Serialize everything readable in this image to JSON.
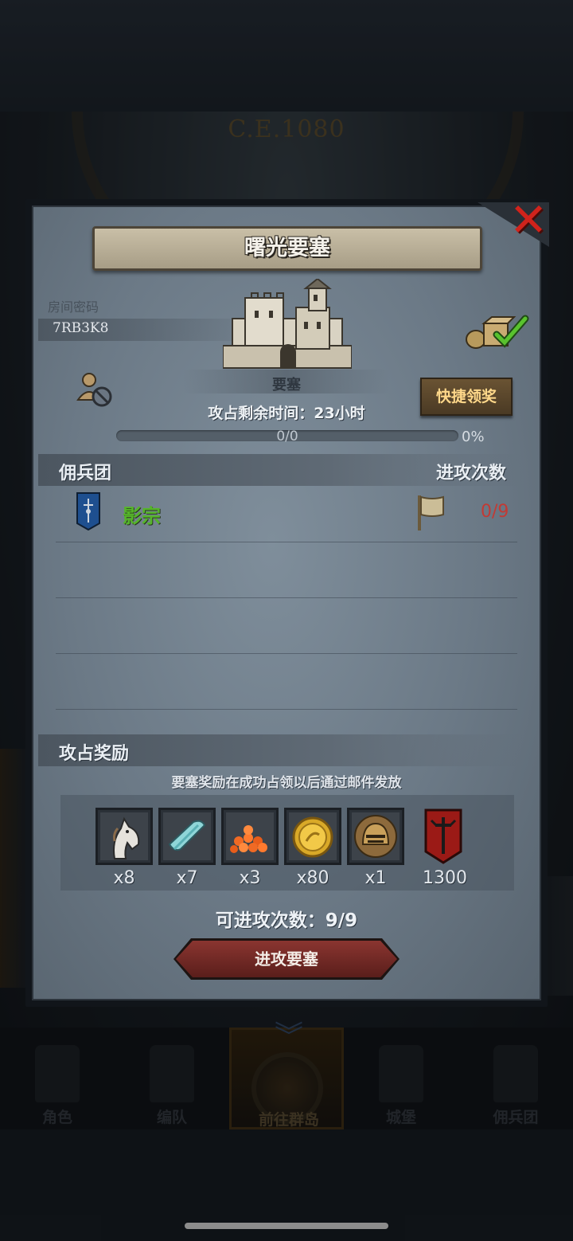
{
  "background": {
    "year": "C.E.1080"
  },
  "bottom_nav": [
    {
      "label": "角色",
      "icon": "knight-icon"
    },
    {
      "label": "编队",
      "icon": "team-icon"
    },
    {
      "label": "前往群岛",
      "icon": "compass-map-icon",
      "active": true
    },
    {
      "label": "城堡",
      "icon": "castle-icon"
    },
    {
      "label": "佣兵团",
      "icon": "ship-icon"
    }
  ],
  "modal": {
    "title": "曙光要塞",
    "room_label": "房间密码",
    "room_code": "7RB3K8",
    "fortress_label": "要塞",
    "quick_claim_label": "快捷领奖",
    "remaining_time": "攻占剩余时间：23小时",
    "progress": {
      "count": "0/0",
      "percent": "0%",
      "fraction": 0
    },
    "mercenary_header": "佣兵团",
    "attack_count_header": "进攻次数",
    "guild": {
      "name": "影宗",
      "attacks": "0/9"
    },
    "rewards_header": "攻占奖励",
    "rewards_note": "要塞奖励在成功占领以后通过邮件发放",
    "rewards": [
      {
        "icon": "horse-icon",
        "count": "x8"
      },
      {
        "icon": "cloth-icon",
        "count": "x7"
      },
      {
        "icon": "orange-beans-icon",
        "count": "x3"
      },
      {
        "icon": "gold-coin-icon",
        "count": "x80"
      },
      {
        "icon": "helmet-icon",
        "count": "x1"
      },
      {
        "icon": "red-banner-icon",
        "count": "1300"
      }
    ],
    "attempts_left": "可进攻次数：9/9",
    "attack_button": "进攻要塞"
  },
  "colors": {
    "guild_name": "#55b52a",
    "attack_count": "#c23a34",
    "quick_btn_text": "#ffd88a",
    "close": "#d0231c"
  }
}
